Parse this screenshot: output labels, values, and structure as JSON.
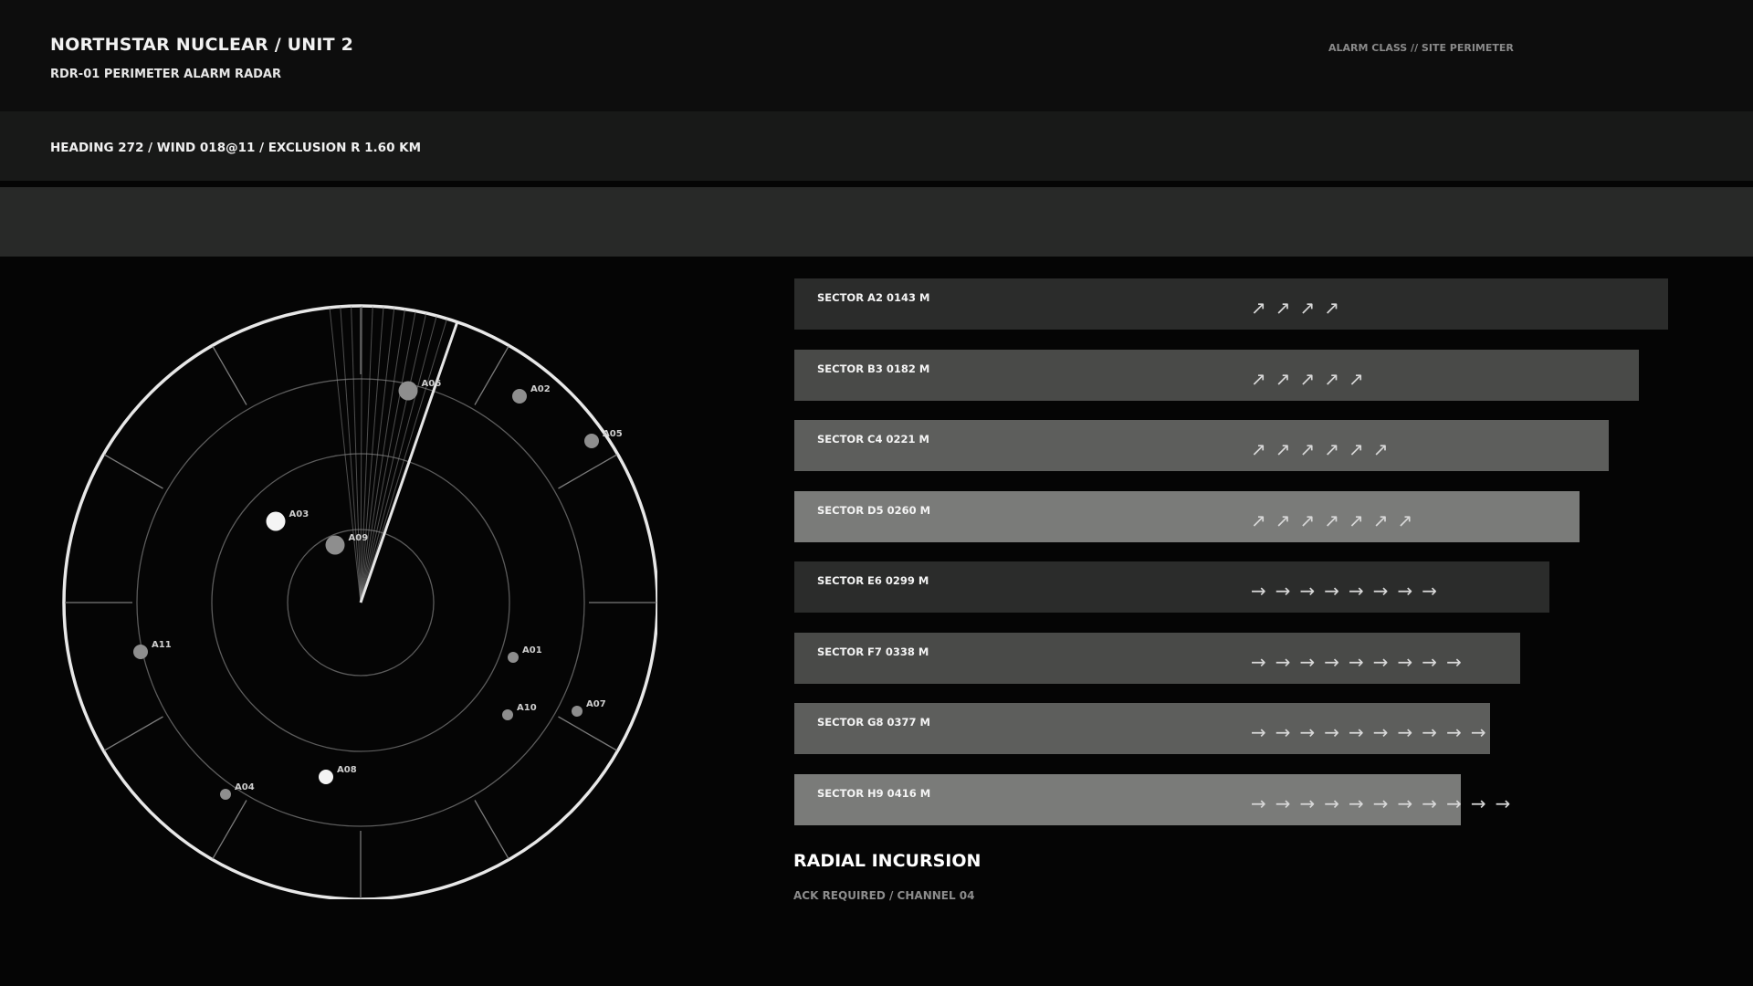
{
  "header": {
    "title": "NORTHSTAR NUCLEAR / UNIT 2",
    "subtitle": "RDR-01  PERIMETER ALARM RADAR",
    "class_label": "ALARM CLASS // SITE PERIMETER"
  },
  "status": {
    "text": "HEADING  272  /  WIND  018@11  /  EXCLUSION R 1.60 KM"
  },
  "colors": {
    "bar_dark": "#2b2c2b",
    "bar_mid": "#494a48",
    "bar_light": "#5d5e5c",
    "bar_lighter": "#7a7b79"
  },
  "radar": {
    "contacts": [
      {
        "id": "A01",
        "size": "small",
        "tone": "grey"
      },
      {
        "id": "A02",
        "size": "medium",
        "tone": "grey"
      },
      {
        "id": "A03",
        "size": "large",
        "tone": "white"
      },
      {
        "id": "A04",
        "size": "small",
        "tone": "grey"
      },
      {
        "id": "A05",
        "size": "medium",
        "tone": "grey"
      },
      {
        "id": "A06",
        "size": "large",
        "tone": "grey"
      },
      {
        "id": "A07",
        "size": "small",
        "tone": "grey"
      },
      {
        "id": "A08",
        "size": "medium",
        "tone": "white"
      },
      {
        "id": "A09",
        "size": "large",
        "tone": "grey"
      },
      {
        "id": "A10",
        "size": "small",
        "tone": "grey"
      },
      {
        "id": "A11",
        "size": "medium",
        "tone": "grey"
      }
    ]
  },
  "sectors": [
    {
      "label": "SECTOR A2  0143 M",
      "value": 143,
      "arrow": "↗",
      "count": 4,
      "tone": "dark"
    },
    {
      "label": "SECTOR B3  0182 M",
      "value": 182,
      "arrow": "↗",
      "count": 5,
      "tone": "mid"
    },
    {
      "label": "SECTOR C4  0221 M",
      "value": 221,
      "arrow": "↗",
      "count": 6,
      "tone": "light"
    },
    {
      "label": "SECTOR D5  0260 M",
      "value": 260,
      "arrow": "↗",
      "count": 7,
      "tone": "lighter"
    },
    {
      "label": "SECTOR E6  0299 M",
      "value": 299,
      "arrow": "→",
      "count": 8,
      "tone": "dark"
    },
    {
      "label": "SECTOR F7  0338 M",
      "value": 338,
      "arrow": "→",
      "count": 9,
      "tone": "mid"
    },
    {
      "label": "SECTOR G8  0377 M",
      "value": 377,
      "arrow": "→",
      "count": 10,
      "tone": "light"
    },
    {
      "label": "SECTOR H9  0416 M",
      "value": 416,
      "arrow": "→",
      "count": 11,
      "tone": "lighter"
    }
  ],
  "alert": {
    "title": "RADIAL INCURSION",
    "subtitle": "ACK REQUIRED / CHANNEL 04"
  }
}
